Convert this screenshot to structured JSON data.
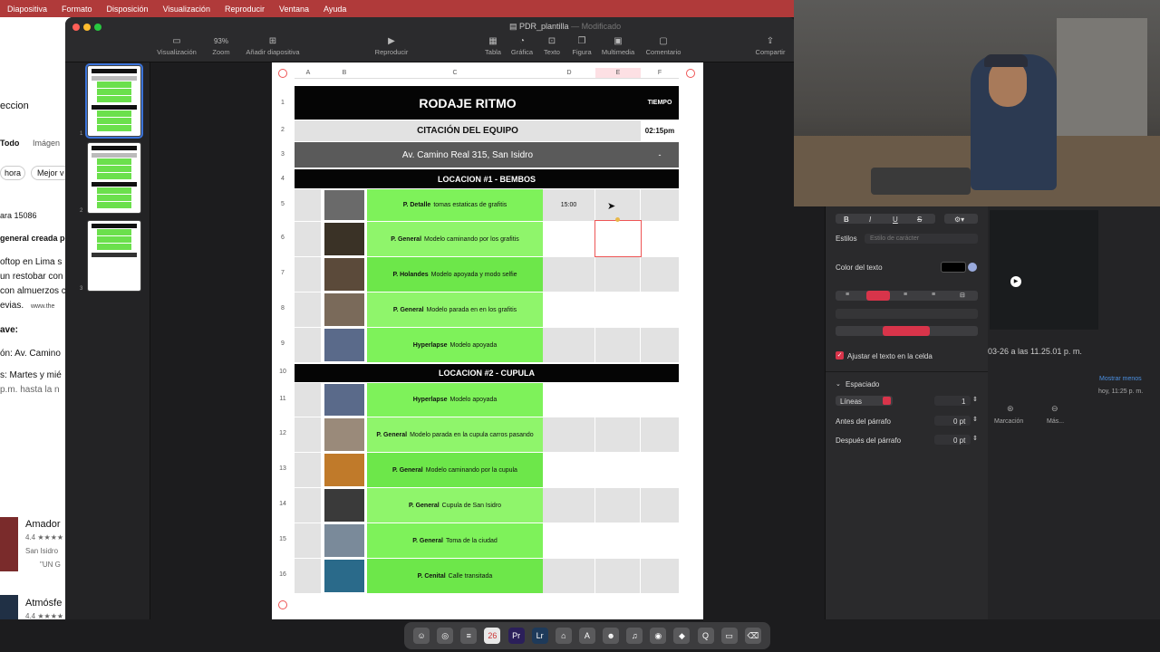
{
  "menubar": {
    "items": [
      "Diapositiva",
      "Formato",
      "Disposición",
      "Visualización",
      "Reproducir",
      "Ventana",
      "Ayuda"
    ]
  },
  "bg_left": {
    "lines": [
      "eccion",
      "Todo",
      "Imágen",
      "hora",
      "Mejor v",
      "ara 15086",
      "general creada po",
      "oftop en Lima s",
      "un restobar con",
      "con almuerzos c",
      "evias.",
      "www.the",
      "ave:",
      "ón: Av. Camino",
      "s: Martes y mié",
      "p.m. hasta la n",
      "Amador",
      "4.4 ★★★★",
      "San Isidro",
      "\"UN G",
      "Atmósfe",
      "4.4 ★★★★"
    ]
  },
  "window": {
    "doc_name": "PDR_plantilla",
    "doc_status": "— Modificado",
    "toolbar": {
      "view": "Visualización",
      "zoom_value": "93%",
      "zoom": "Zoom",
      "add_slide": "Añadir diapositiva",
      "play": "Reproducir",
      "table": "Tabla",
      "chart": "Gráfica",
      "text": "Texto",
      "shape": "Figura",
      "media": "Multimedia",
      "comment": "Comentario",
      "share": "Compartir"
    },
    "slide_numbers": [
      "1",
      "2",
      "3"
    ]
  },
  "table": {
    "columns": [
      "A",
      "B",
      "C",
      "D",
      "E",
      "F"
    ],
    "title": "RODAJE RITMO",
    "time_header": "TIEMPO",
    "team_call": "CITACIÓN DEL EQUIPO",
    "team_call_time": "02:15pm",
    "address": "Av. Camino Real 315, San Isidro",
    "address_dash": "-",
    "location1": "LOCACION #1 - BEMBOS",
    "location2": "LOCACION #2 - CUPULA",
    "shots": [
      {
        "row": "5",
        "type": "P. Detalle",
        "desc": "tomas estaticas de grafitis",
        "time": "15:00"
      },
      {
        "row": "6",
        "type": "P. General",
        "desc": "Modelo caminando por los grafitis",
        "time": ""
      },
      {
        "row": "7",
        "type": "P. Holandes",
        "desc": "Modelo apoyada y modo selfie",
        "time": ""
      },
      {
        "row": "8",
        "type": "P. General",
        "desc": "Modelo parada en en los grafitis",
        "time": ""
      },
      {
        "row": "9",
        "type": "Hyperlapse",
        "desc": "Modelo apoyada",
        "time": ""
      },
      {
        "row": "11",
        "type": "Hyperlapse",
        "desc": "Modelo apoyada",
        "time": ""
      },
      {
        "row": "12",
        "type": "P. General",
        "desc": "Modelo parada en la cupula carros pasando",
        "time": ""
      },
      {
        "row": "13",
        "type": "P. General",
        "desc": "Modelo caminando por la cupula",
        "time": ""
      },
      {
        "row": "14",
        "type": "P. General",
        "desc": "Cupula de San Isidro",
        "time": ""
      },
      {
        "row": "15",
        "type": "P. General",
        "desc": "Toma de la ciudad",
        "time": ""
      },
      {
        "row": "16",
        "type": "P. Cenital",
        "desc": "Calle transitada",
        "time": ""
      }
    ],
    "row_labels": [
      "1",
      "2",
      "3",
      "4",
      "10"
    ]
  },
  "inspector": {
    "bold": "B",
    "italic": "I",
    "underline": "U",
    "strike": "S",
    "styles_label": "Estilos",
    "styles_placeholder": "Estilo de carácter",
    "text_color_label": "Color del texto",
    "wrap_label": "Ajustar el texto en la celda",
    "spacing_label": "Espaciado",
    "lines_option": "Líneas",
    "lines_value": "1",
    "before_label": "Antes del párrafo",
    "before_value": "0 pt",
    "after_label": "Después del párrafo",
    "after_value": "0 pt"
  },
  "bg_right": {
    "date_text": "03-26 a las 11.25.01 p. m.",
    "show_less": "Mostrar menos",
    "today_text": "hoy, 11:25 p. m.",
    "markup": "Marcación",
    "more": "Más..."
  },
  "dock": {
    "calendar_day": "26"
  },
  "colors": {
    "menubar": "#b03a3a",
    "green_cell": "#7ef25a",
    "accent_red": "#d8344a"
  }
}
